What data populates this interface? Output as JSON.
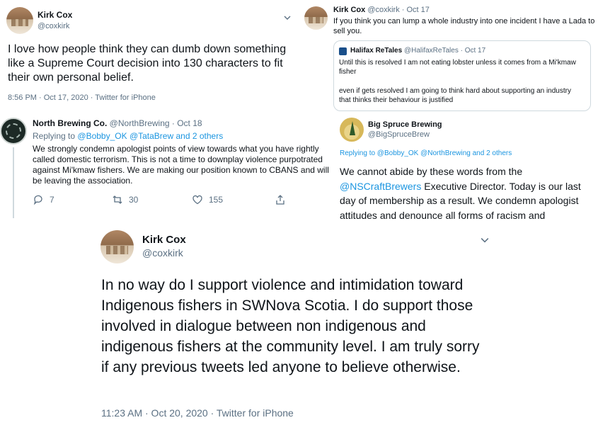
{
  "tweet1": {
    "name": "Kirk Cox",
    "handle": "@coxkirk",
    "body": "I love how people think they can dumb down something like a Supreme Court decision into 130 characters to fit their own personal belief.",
    "meta": "8:56 PM · Oct 17, 2020 · Twitter for iPhone"
  },
  "tweet2": {
    "name": "Kirk Cox",
    "handle_date": "@coxkirk · Oct 17",
    "body": "If you think you can lump a whole industry into one incident I have a Lada to sell you.",
    "quote": {
      "name": "Halifax ReTales",
      "handle_date": "@HalifaxReTales · Oct 17",
      "line1": "Until this is resolved I am not eating lobster unless it comes from a Mi'kmaw fisher",
      "line2": "even if gets resolved I am going to think hard about supporting an industry that thinks their behaviour is justified"
    }
  },
  "tweet3": {
    "name": "North Brewing Co.",
    "handle_date": "@NorthBrewing · Oct 18",
    "replying_prefix": "Replying to",
    "replying_users": "@Bobby_OK @TataBrew and 2 others",
    "body": "We strongly condemn apologist points of view towards what you have rightly called domestic terrorism. This is not a time to downplay violence purpotrated against Mi'kmaw fishers. We are making our position known to CBANS and will be leaving the association.",
    "replies": "7",
    "retweets": "30",
    "likes": "155"
  },
  "tweet4": {
    "name": "Big Spruce Brewing",
    "handle": "@BigSpruceBrew",
    "replying": "Replying to @Bobby_OK @NorthBrewing and 2 others",
    "body_pre": "We cannot abide by these words from the",
    "mention": "@NSCraftBrewers",
    "body_post": " Executive Director. Today is our last day of membership as a result. We condemn apologist attitudes and denounce all forms of racism and"
  },
  "tweet5": {
    "name": "Kirk Cox",
    "handle": "@coxkirk",
    "body": "In no way do I support violence and intimidation toward Indigenous fishers in SWNova Scotia. I do support those involved in dialogue between non indigenous and indigenous fishers at the community level.  I am truly sorry if any previous tweets led anyone to believe otherwise.",
    "meta": "11:23 AM · Oct 20, 2020 · Twitter for iPhone"
  },
  "icons": [
    "chevron-down-icon",
    "reply-icon",
    "retweet-icon",
    "like-icon",
    "share-icon"
  ],
  "colors": {
    "link": "#1b95e0",
    "muted": "#5b7083",
    "text": "#0f1419"
  }
}
